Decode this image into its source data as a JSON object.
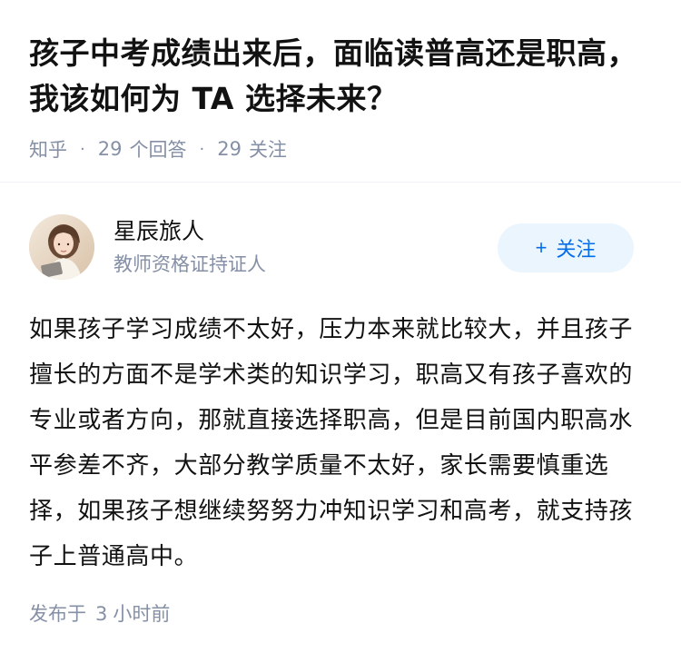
{
  "question": {
    "title": "孩子中考成绩出来后，面临读普高还是职高，我该如何为 TA 选择未来？",
    "source": "知乎",
    "answers_count": "29",
    "answers_label": "个回答",
    "followers_count": "29",
    "followers_label": "关注"
  },
  "author": {
    "name": "星辰旅人",
    "badge": "教师资格证持证人",
    "follow_label": "关注",
    "follow_icon": "plus-icon",
    "avatar_icon": "user-avatar"
  },
  "answer": {
    "content": "如果孩子学习成绩不太好，压力本来就比较大，并且孩子擅长的方面不是学术类的知识学习，职高又有孩子喜欢的专业或者方向，那就直接选择职高，但是目前国内职高水平参差不齐，大部分教学质量不太好，家长需要慎重选择，如果孩子想继续努努力冲知识学习和高考，就支持孩子上普通高中。",
    "published_label": "发布于",
    "published_num": "3",
    "published_unit": "小时前"
  },
  "colors": {
    "accent": "#056de8",
    "button_bg": "#ebf5fd",
    "meta_gray": "#8590a6",
    "text": "#121212"
  }
}
